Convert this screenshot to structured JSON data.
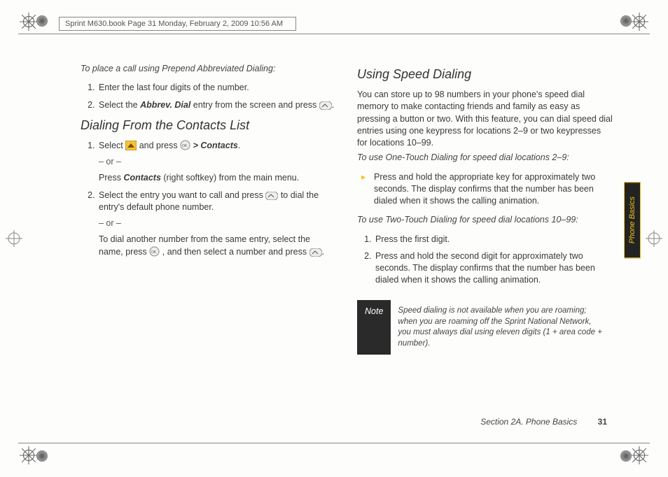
{
  "header": "Sprint M630.book  Page 31  Monday, February 2, 2009  10:56 AM",
  "sidetab": "Phone Basics",
  "left": {
    "lead": "To place a call using Prepend Abbreviated Dialing:",
    "step1": "Enter the last four digits of the number.",
    "step2a": "Select the ",
    "step2b_bold": "Abbrev. Dial",
    "step2c": " entry from the screen and press ",
    "heading": "Dialing From the Contacts List",
    "c1a": "Select ",
    "c1b": " and press ",
    "c1c_bold": " > Contacts",
    "c1d": ".",
    "or": "– or –",
    "c1e": "Press ",
    "c1e_bold": "Contacts",
    "c1f": " (right softkey) from the main menu.",
    "c2a": "Select the entry you want to call and press ",
    "c2b": " to dial the entry's default phone number.",
    "c2c": "To dial another number from the same entry, select the name, press ",
    "c2d": ", and then select a number and press ",
    "period": "."
  },
  "right": {
    "heading": "Using Speed Dialing",
    "intro": "You can store up to 98 numbers in your phone's speed dial memory to make contacting friends and family as easy as pressing a button or two. With this feature, you can dial speed dial entries using one keypress for locations 2–9 or two keypresses for locations 10–99.",
    "sub1": "To use One-Touch Dialing for speed dial locations 2–9:",
    "bullet": "Press and hold the appropriate key for approximately two seconds. The display confirms that the number has been dialed when it shows the calling animation.",
    "sub2": "To use Two-Touch Dialing for speed dial locations 10–99:",
    "s1": "Press the first digit.",
    "s2": "Press and hold the second digit for approximately two seconds. The display confirms that the number has been dialed when it shows the calling animation.",
    "note_label": "Note",
    "note_text": "Speed dialing is not available when you are roaming; when you are roaming off the Sprint National Network, you must always dial using eleven digits (1 + area code + number)."
  },
  "footer": {
    "section": "Section 2A. Phone Basics",
    "page": "31"
  }
}
